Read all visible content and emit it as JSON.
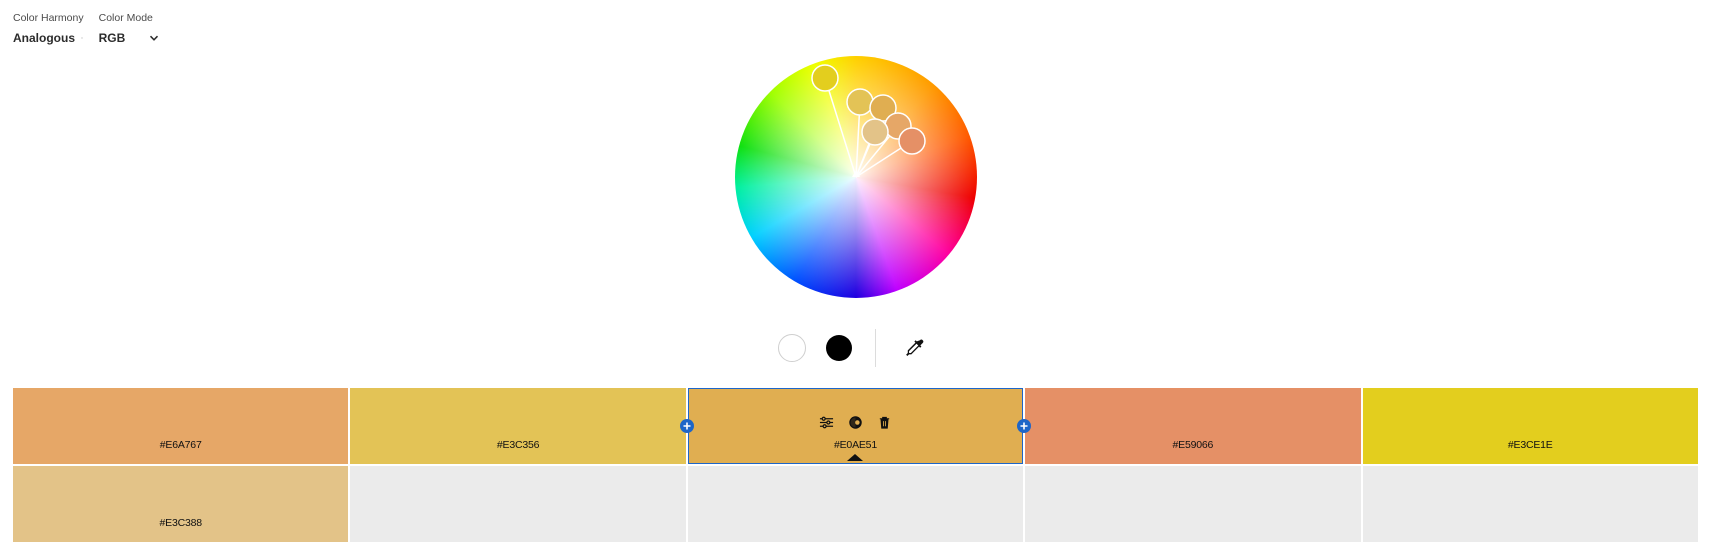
{
  "controls": {
    "harmony": {
      "label": "Color Harmony",
      "value": "Analogous"
    },
    "mode": {
      "label": "Color Mode",
      "value": "RGB"
    }
  },
  "tools": {
    "white_icon": "white-swatch",
    "black_icon": "black-swatch",
    "eyedropper_icon": "eyedropper-icon"
  },
  "palette": {
    "row1": [
      {
        "hex": "#E6A767",
        "color": "#E6A767"
      },
      {
        "hex": "#E3C356",
        "color": "#E3C356"
      },
      {
        "hex": "#E0AE51",
        "color": "#E0AE51",
        "selected": true
      },
      {
        "hex": "#E59066",
        "color": "#E59066"
      },
      {
        "hex": "#E3CE1E",
        "color": "#E3CE1E"
      }
    ],
    "row2": [
      {
        "hex": "#E3C388",
        "color": "#E3C388"
      }
    ]
  },
  "colors": {
    "accent": "#1E66C8",
    "empty_cell": "#EBEBEB"
  }
}
